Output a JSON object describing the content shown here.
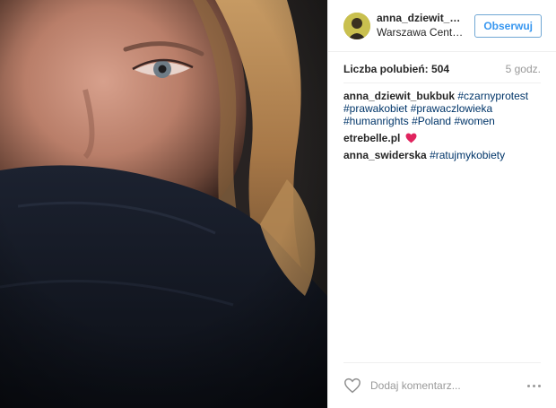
{
  "post": {
    "image_description_icon": "photo",
    "header": {
      "username": "anna_dziewit_bukbuk",
      "location": "Warszawa Centrum",
      "follow_label": "Obserwuj"
    },
    "likes": {
      "label": "Liczba polubień:",
      "count": "504",
      "time_ago": "5 godz."
    },
    "caption": {
      "user": "anna_dziewit_bukbuk",
      "tags": [
        "#czarnyprotest",
        "#prawakobiet",
        "#prawaczlowieka",
        "#humanrights",
        "#Poland",
        "#women"
      ]
    },
    "comments": [
      {
        "user": "etrebelle.pl",
        "text": "",
        "emoji": "red-heart-icon"
      },
      {
        "user": "anna_swiderska",
        "tag": "#ratujmykobiety"
      }
    ],
    "footer": {
      "add_comment_placeholder": "Dodaj komentarz...",
      "like_icon": "heart-outline-icon",
      "more_icon": "more-options-icon"
    },
    "colors": {
      "follow_blue": "#3897f0",
      "hashtag": "#003569",
      "muted": "#999999",
      "heart_red": "#e0245e"
    }
  }
}
